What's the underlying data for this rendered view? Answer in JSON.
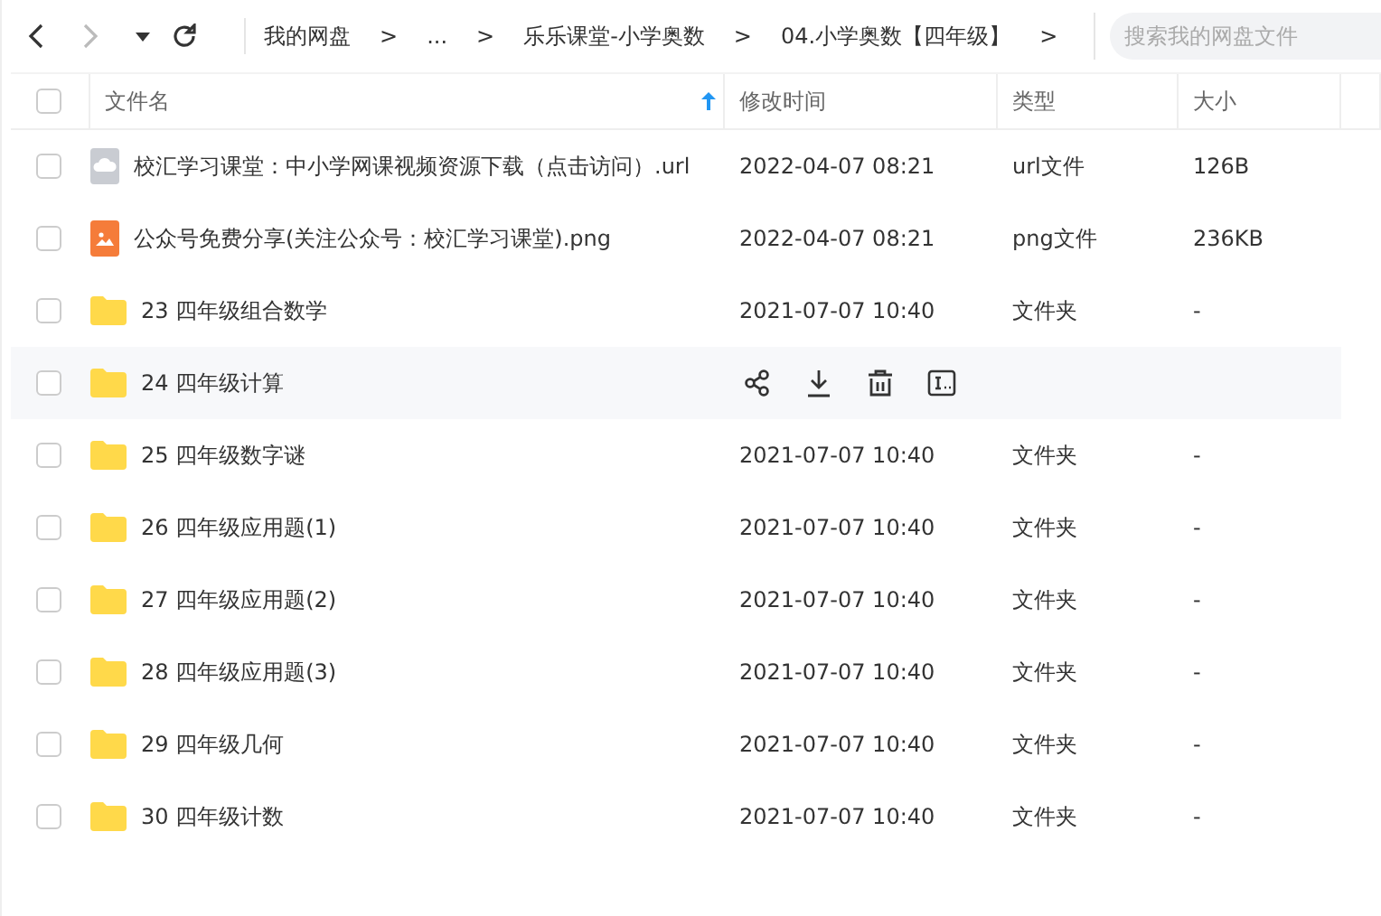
{
  "toolbar": {
    "breadcrumbs": [
      {
        "label": "我的网盘"
      },
      {
        "label": "..."
      },
      {
        "label": "乐乐课堂-小学奥数"
      },
      {
        "label": "04.小学奥数【四年级】"
      }
    ],
    "separator": ">",
    "search": {
      "placeholder": "搜索我的网盘文件"
    }
  },
  "table": {
    "select_all_checked": false,
    "columns": [
      {
        "label": "文件名",
        "sorted": true
      },
      {
        "label": "修改时间",
        "sorted": false
      },
      {
        "label": "类型",
        "sorted": false
      },
      {
        "label": "大小",
        "sorted": false
      }
    ],
    "rows": [
      {
        "kind": "url",
        "name": "校汇学习课堂：中小学网课视频资源下载（点击访问）.url",
        "modified": "2022-04-07 08:21",
        "type": "url文件",
        "size": "126B",
        "hovered": false
      },
      {
        "kind": "image",
        "name": "公众号免费分享(关注公众号：校汇学习课堂).png",
        "modified": "2022-04-07 08:21",
        "type": "png文件",
        "size": "236KB",
        "hovered": false
      },
      {
        "kind": "folder",
        "name": "23 四年级组合数学",
        "modified": "2021-07-07 10:40",
        "type": "文件夹",
        "size": "-",
        "hovered": false
      },
      {
        "kind": "folder",
        "name": "24 四年级计算",
        "hovered": true
      },
      {
        "kind": "folder",
        "name": "25 四年级数字谜",
        "modified": "2021-07-07 10:40",
        "type": "文件夹",
        "size": "-",
        "hovered": false
      },
      {
        "kind": "folder",
        "name": "26 四年级应用题(1)",
        "modified": "2021-07-07 10:40",
        "type": "文件夹",
        "size": "-",
        "hovered": false
      },
      {
        "kind": "folder",
        "name": "27 四年级应用题(2)",
        "modified": "2021-07-07 10:40",
        "type": "文件夹",
        "size": "-",
        "hovered": false
      },
      {
        "kind": "folder",
        "name": "28 四年级应用题(3)",
        "modified": "2021-07-07 10:40",
        "type": "文件夹",
        "size": "-",
        "hovered": false
      },
      {
        "kind": "folder",
        "name": "29 四年级几何",
        "modified": "2021-07-07 10:40",
        "type": "文件夹",
        "size": "-",
        "hovered": false
      },
      {
        "kind": "folder",
        "name": "30 四年级计数",
        "modified": "2021-07-07 10:40",
        "type": "文件夹",
        "size": "-",
        "hovered": false
      }
    ]
  }
}
